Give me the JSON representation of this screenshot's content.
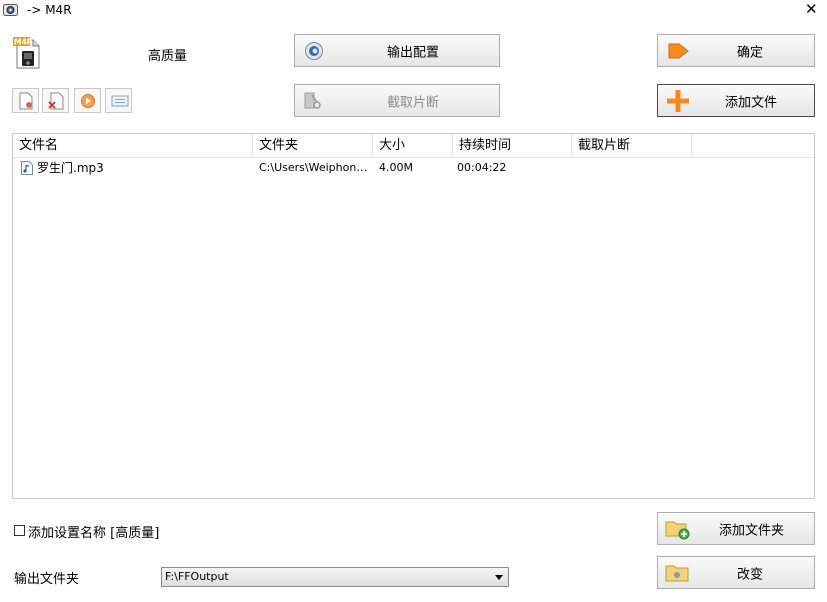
{
  "window": {
    "title": "-> M4R",
    "close_glyph": "✕"
  },
  "profile": {
    "format_icon_text": "M4R",
    "quality_label": "高质量"
  },
  "buttons": {
    "output_config": "输出配置",
    "confirm": "确定",
    "clip": "截取片断",
    "add_file": "添加文件",
    "add_folder": "添加文件夹",
    "change": "改变"
  },
  "toolbar": {
    "icons": [
      "remove-file-icon",
      "clear-list-icon",
      "play-icon",
      "info-icon"
    ]
  },
  "table": {
    "columns": [
      "文件名",
      "文件夹",
      "大小",
      "持续时间",
      "截取片断",
      ""
    ],
    "rows": [
      {
        "name": "罗生门.mp3",
        "folder": "C:\\Users\\Weiphone\\...",
        "size": "4.00M",
        "duration": "00:04:22",
        "clip": ""
      }
    ]
  },
  "options": {
    "add_settings_name_label": "添加设置名称 [高质量]",
    "add_settings_name_checked": false
  },
  "output": {
    "folder_label": "输出文件夹",
    "folder_value": "F:\\FFOutput"
  },
  "colors": {
    "accent_orange": "#f58a1f",
    "border": "#adadad"
  }
}
